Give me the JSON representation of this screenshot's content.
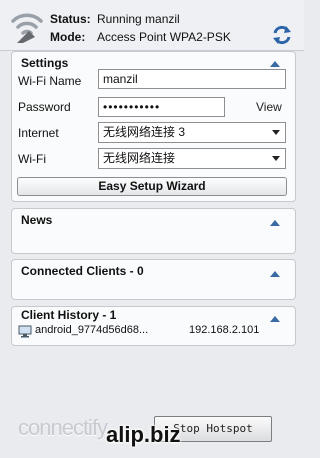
{
  "header": {
    "status_label": "Status:",
    "status_value": "Running manzil",
    "mode_label": "Mode:",
    "mode_value": "Access Point WPA2-PSK",
    "logo_icon": "wifi-broadcast-icon",
    "refresh_icon": "refresh-icon"
  },
  "settings": {
    "title": "Settings",
    "wifi_name_label": "Wi-Fi Name",
    "wifi_name_value": "manzil",
    "password_label": "Password",
    "password_value": "•••••••••••",
    "view_label": "View",
    "internet_label": "Internet",
    "internet_value": "无线网络连接 3",
    "wifi_label": "Wi-Fi",
    "wifi_value": "无线网络连接",
    "easy_setup_label": "Easy Setup Wizard"
  },
  "news": {
    "title": "News"
  },
  "clients": {
    "title": "Connected Clients - 0"
  },
  "history": {
    "title": "Client History - 1",
    "rows": [
      {
        "name": "android_9774d56d68...",
        "ip": "192.168.2.101"
      }
    ]
  },
  "footer": {
    "logo_text": "connectify",
    "stop_label": "Stop Hotspot",
    "watermark": "alip.biz"
  },
  "colors": {
    "accent": "#1f5fa8",
    "background": "#e9ebee",
    "panel": "#fafbfc"
  }
}
